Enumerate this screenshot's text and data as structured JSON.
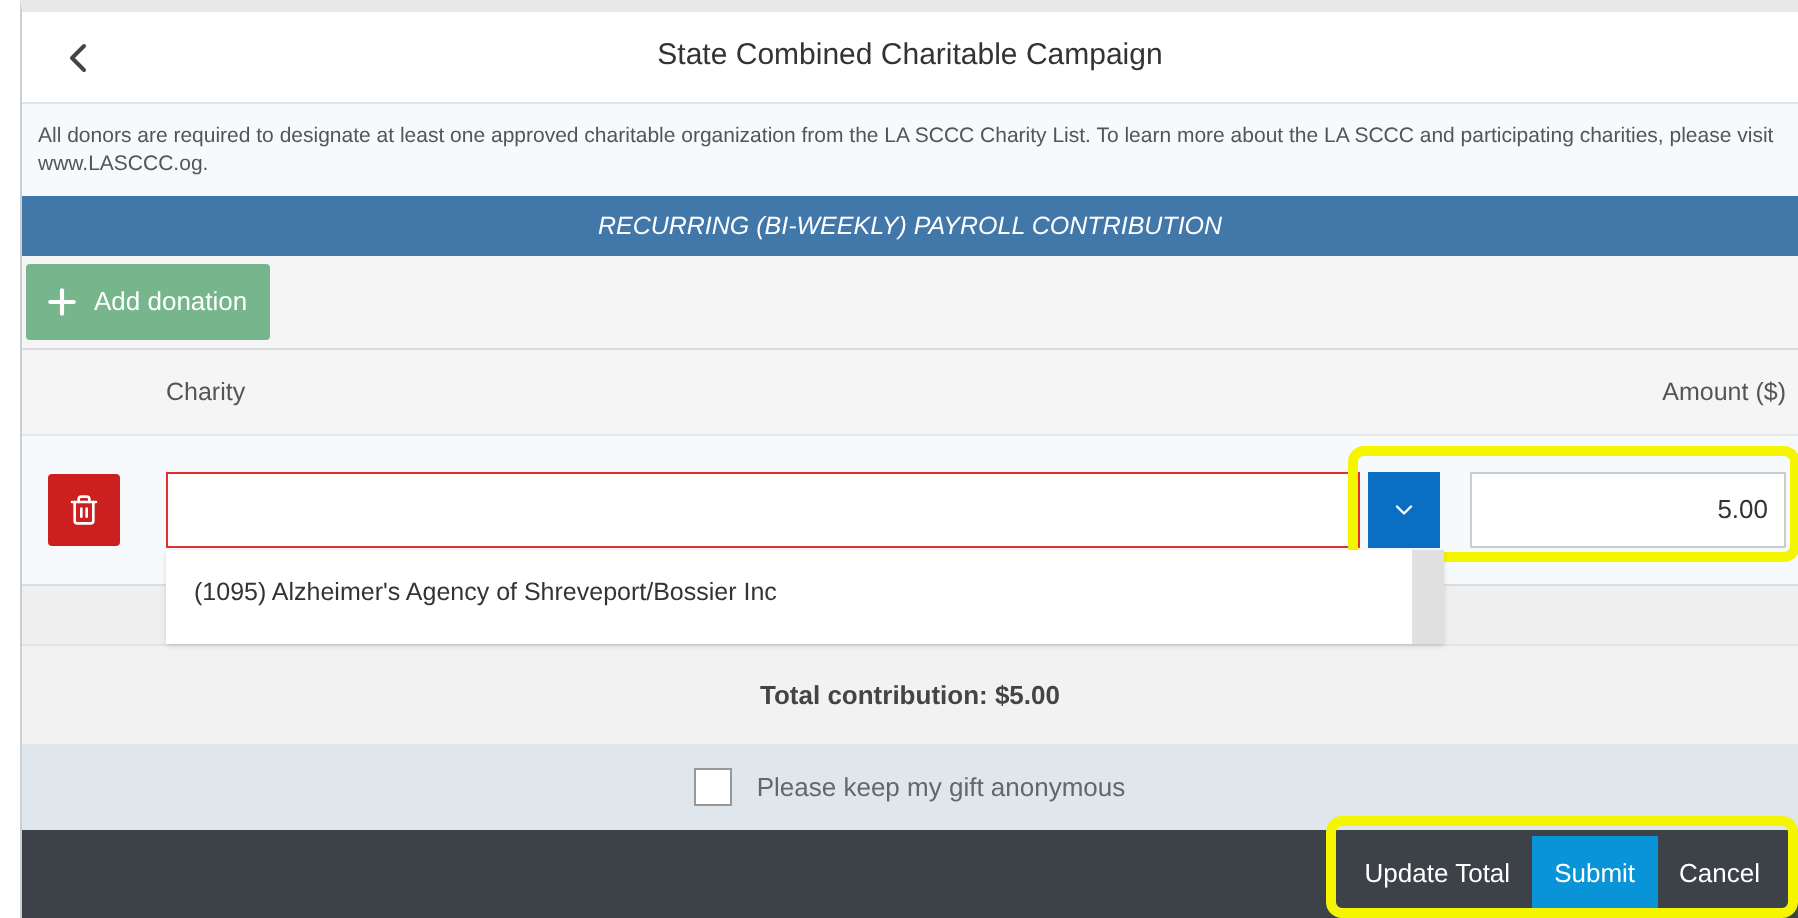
{
  "header": {
    "title": "State Combined Charitable Campaign"
  },
  "notice": "All donors are required to designate at least one approved charitable organization from the LA SCCC Charity List. To learn more about the LA SCCC and participating charities, please visit www.LASCCC.og.",
  "section_title": "RECURRING (BI-WEEKLY) PAYROLL CONTRIBUTION",
  "add_button": {
    "label": "Add donation"
  },
  "table": {
    "columns": [
      "Charity",
      "Amount ($)"
    ],
    "rows": [
      {
        "charity_invalid": true,
        "amount": "5.00",
        "highlighted": true,
        "dropdown_open": true,
        "options": [
          "(1095) Alzheimer's Agency of Shreveport/Bossier Inc"
        ]
      }
    ]
  },
  "total": "Total contribution: $5.00",
  "anonymous": {
    "label": "Please keep my gift anonymous",
    "checked": false
  },
  "footer": {
    "highlighted": true,
    "buttons": [
      {
        "label": "Update Total",
        "kind": "plain"
      },
      {
        "label": "Submit",
        "kind": "primary"
      },
      {
        "label": "Cancel",
        "kind": "plain"
      }
    ]
  }
}
